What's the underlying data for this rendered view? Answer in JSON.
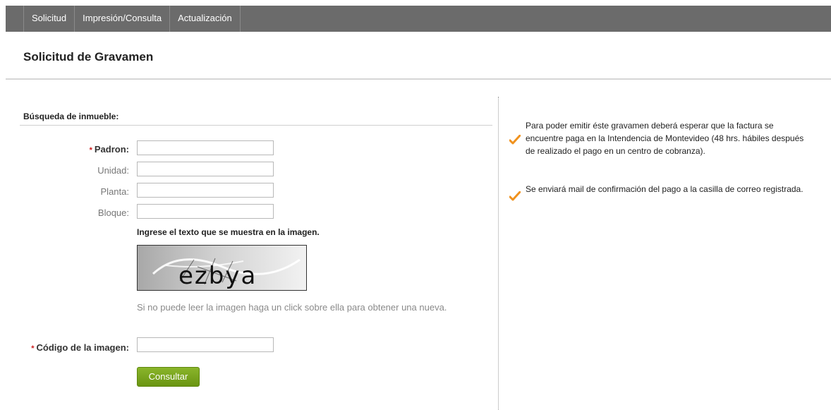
{
  "nav": {
    "tabs": [
      {
        "label": "Solicitud"
      },
      {
        "label": "Impresión/Consulta"
      },
      {
        "label": "Actualización"
      }
    ]
  },
  "page": {
    "title": "Solicitud de Gravamen"
  },
  "search": {
    "heading": "Búsqueda de inmueble:",
    "fields": {
      "padron": {
        "label": "Padron:",
        "value": "",
        "required": true
      },
      "unidad": {
        "label": "Unidad:",
        "value": ""
      },
      "planta": {
        "label": "Planta:",
        "value": ""
      },
      "bloque": {
        "label": "Bloque:",
        "value": ""
      }
    },
    "required_mark": "*"
  },
  "captcha": {
    "prompt": "Ingrese el texto que se muestra en la imagen.",
    "image_text": "ezbya",
    "hint": "Si no puede leer la imagen haga un click sobre ella para obtener una nueva.",
    "code_label": "Código de la imagen:",
    "code_value": ""
  },
  "actions": {
    "submit_label": "Consultar",
    "submit_color": "#7aa61f"
  },
  "notes": [
    {
      "text": "Para poder emitir éste gravamen deberá esperar que la factura se encuentre paga en la Intendencia de Montevideo (48 hrs. hábiles después de realizado el pago en un centro de cobranza).",
      "icon": "checkmark-icon"
    },
    {
      "text": "Se enviará mail de confirmación del pago a la casilla de correo registrada.",
      "icon": "checkmark-icon"
    }
  ],
  "colors": {
    "nav_bg": "#6b6b6b",
    "check": "#f0921e",
    "required_star": "#cc1d1d"
  }
}
